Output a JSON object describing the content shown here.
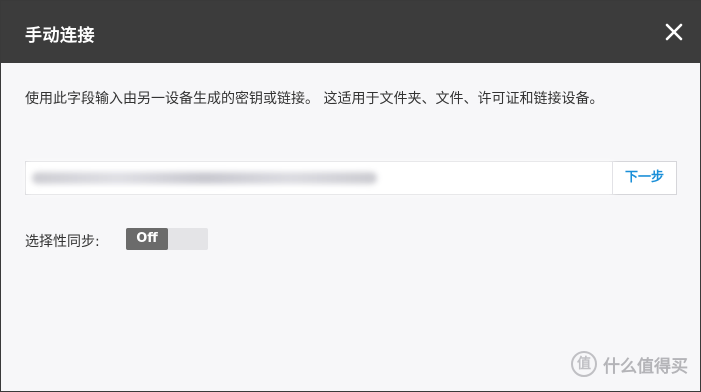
{
  "dialog": {
    "title": "手动连接",
    "description": "使用此字段输入由另一设备生成的密钥或链接。 这适用于文件夹、文件、许可证和链接设备。",
    "link_input": {
      "value": "",
      "placeholder": ""
    },
    "next_label": "下一步",
    "sync_label": "选择性同步:",
    "toggle_state": "Off"
  },
  "watermark": {
    "text": "什么值得买"
  },
  "icons": {
    "close": "close-icon",
    "watermark": "watermark-logo-icon"
  },
  "colors": {
    "titlebar": "#3c3c3c",
    "accent": "#1a8fd8",
    "toggle_off": "#6b6b6b"
  }
}
